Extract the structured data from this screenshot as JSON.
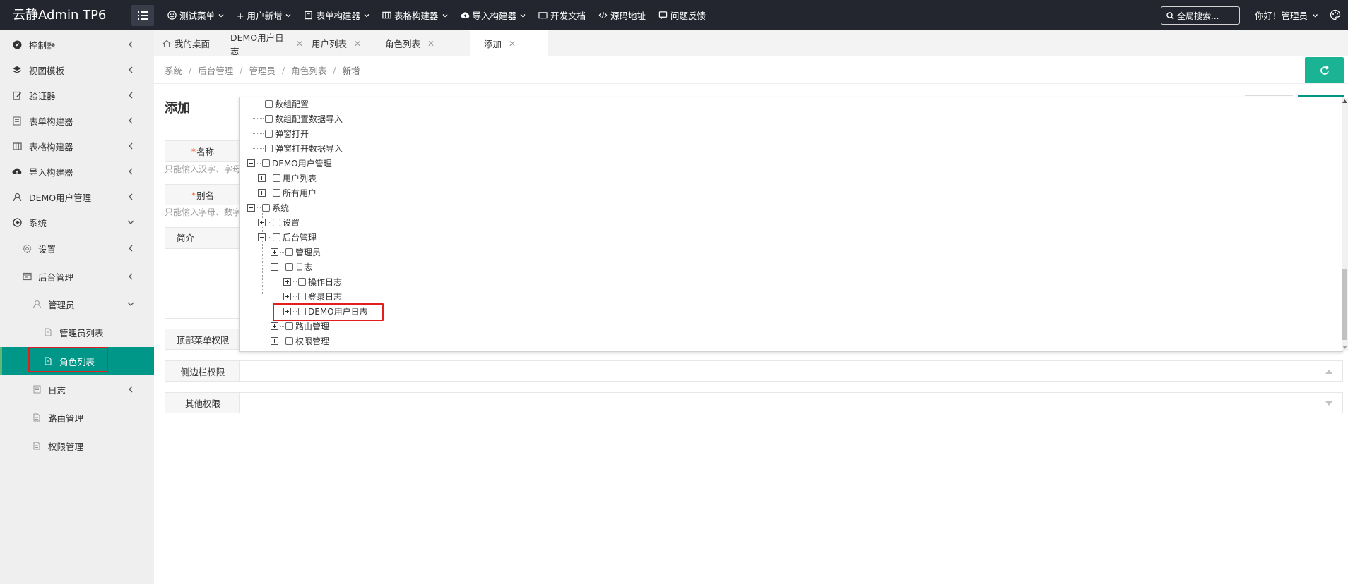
{
  "app": {
    "title": "云静Admin TP6"
  },
  "topnav": [
    {
      "label": "测试菜单",
      "icon": "smile-icon"
    },
    {
      "label": "+ 用户新增",
      "icon": ""
    },
    {
      "label": "表单构建器",
      "icon": "form-icon"
    },
    {
      "label": "表格构建器",
      "icon": "table-icon"
    },
    {
      "label": "导入构建器",
      "icon": "cloud-upload-icon"
    },
    {
      "label": "开发文档",
      "icon": "book-icon"
    },
    {
      "label": "源码地址",
      "icon": "code-icon"
    },
    {
      "label": "问题反馈",
      "icon": "chat-icon"
    }
  ],
  "search": {
    "placeholder": "全局搜索..."
  },
  "user": {
    "greeting": "你好！管理员"
  },
  "sidebar": {
    "items": [
      {
        "label": "控制器",
        "icon": "compass-icon"
      },
      {
        "label": "视图模板",
        "icon": "layers-icon"
      },
      {
        "label": "验证器",
        "icon": "edit-icon"
      },
      {
        "label": "表单构建器",
        "icon": "form-icon"
      },
      {
        "label": "表格构建器",
        "icon": "table-icon"
      },
      {
        "label": "导入构建器",
        "icon": "cloud-upload-icon"
      },
      {
        "label": "DEMO用户管理",
        "icon": "user-icon"
      },
      {
        "label": "系统",
        "icon": "system-icon"
      },
      {
        "label": "设置",
        "icon": "gear-icon"
      },
      {
        "label": "后台管理",
        "icon": "admin-icon"
      },
      {
        "label": "管理员",
        "icon": "user-icon"
      },
      {
        "label": "管理员列表",
        "icon": "file-icon"
      },
      {
        "label": "角色列表",
        "icon": "file-icon"
      },
      {
        "label": "日志",
        "icon": "log-icon"
      },
      {
        "label": "路由管理",
        "icon": "file-icon"
      },
      {
        "label": "权限管理",
        "icon": "file-icon"
      }
    ]
  },
  "tabs": [
    {
      "label": "我的桌面"
    },
    {
      "label": "DEMO用户日志"
    },
    {
      "label": "用户列表"
    },
    {
      "label": "角色列表"
    },
    {
      "label": "添加"
    }
  ],
  "breadcrumb": [
    "系统",
    "后台管理",
    "管理员",
    "角色列表",
    "新增"
  ],
  "form": {
    "title": "添加",
    "name_label": "名称",
    "name_hint": "只能输入汉字、字母",
    "alias_label": "别名",
    "alias_hint": "只能输入字母、数字",
    "intro_label": "简介",
    "top_menu_label": "顶部菜单权限",
    "sidebar_label": "侧边栏权限",
    "other_label": "其他权限",
    "required_mark": "*"
  },
  "tree": {
    "nodes": [
      {
        "label": "数组配置"
      },
      {
        "label": "数组配置数据导入"
      },
      {
        "label": "弹窗打开"
      },
      {
        "label": "弹窗打开数据导入"
      },
      {
        "label": "DEMO用户管理"
      },
      {
        "label": "用户列表"
      },
      {
        "label": "所有用户"
      },
      {
        "label": "系统"
      },
      {
        "label": "设置"
      },
      {
        "label": "后台管理"
      },
      {
        "label": "管理员"
      },
      {
        "label": "日志"
      },
      {
        "label": "操作日志"
      },
      {
        "label": "登录日志"
      },
      {
        "label": "DEMO用户日志"
      },
      {
        "label": "路由管理"
      },
      {
        "label": "权限管理"
      }
    ]
  },
  "colors": {
    "topbar": "#23262e",
    "sidebar": "#efefef",
    "active": "#009688",
    "refresh": "#1ab394",
    "highlight": "#e02020"
  }
}
